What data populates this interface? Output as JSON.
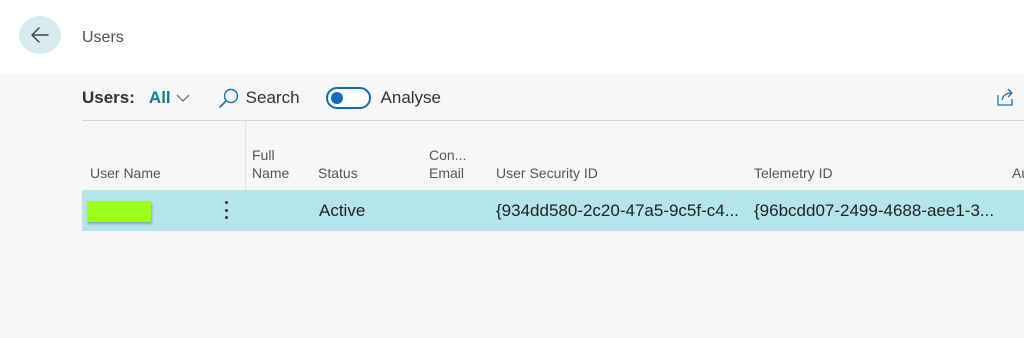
{
  "page": {
    "title": "Users"
  },
  "actionbar": {
    "view_label": "Users:",
    "view_value": "All",
    "search_label": "Search",
    "analyse_label": "Analyse",
    "analyse_on": false
  },
  "table": {
    "columns": [
      {
        "label_line1": "User Name",
        "label_line2": ""
      },
      {
        "label_line1": "Full",
        "label_line2": "Name"
      },
      {
        "label_line1": "Status",
        "label_line2": ""
      },
      {
        "label_line1": "Con...",
        "label_line2": "Email"
      },
      {
        "label_line1": "User Security ID",
        "label_line2": ""
      },
      {
        "label_line1": "Telemetry ID",
        "label_line2": ""
      },
      {
        "label_line1": "Au",
        "label_line2": ""
      }
    ],
    "rows": [
      {
        "user_name": "",
        "full_name": "",
        "status": "Active",
        "contact_email": "",
        "user_security_id": "{934dd580-2c20-47a5-9c5f-c4...",
        "telemetry_id": "{96bcdd07-2499-4688-aee1-3..."
      }
    ]
  },
  "colors": {
    "accent": "#00838f",
    "selected_row": "#b3e5ea",
    "toggle": "#0f6cbd",
    "redaction": "#9cff1a"
  },
  "icons": {
    "back": "arrow-left-icon",
    "view_dropdown": "chevron-down-icon",
    "search": "search-icon",
    "share": "share-icon",
    "row_menu": "more-vertical-icon"
  }
}
